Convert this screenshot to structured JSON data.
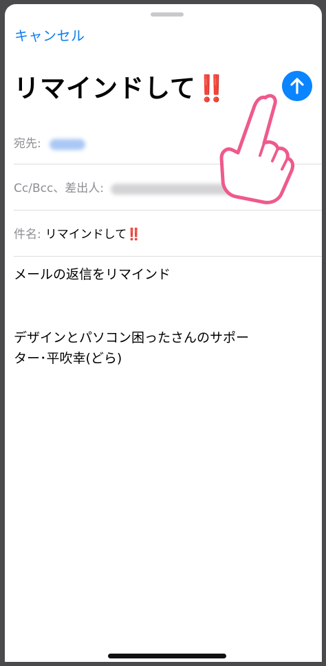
{
  "header": {
    "cancel_label": "キャンセル",
    "title": "リマインドして",
    "title_emoji": "‼️",
    "send_icon": "arrow-up-icon"
  },
  "fields": {
    "to_label": "宛先:",
    "cc_label": "Cc/Bcc、差出人:",
    "subject_label": "件名:",
    "subject_value": "リマインドして",
    "subject_emoji": "‼️"
  },
  "body": {
    "line1": "メールの返信をリマインド",
    "line2": "デザインとパソコン困ったさんのサポー",
    "line3": "ター･平吹幸(どら)"
  },
  "colors": {
    "accent": "#0a84ff",
    "link": "#0b7df0",
    "emphasis": "#e0202a",
    "hand_outline": "#ee5a8c"
  }
}
